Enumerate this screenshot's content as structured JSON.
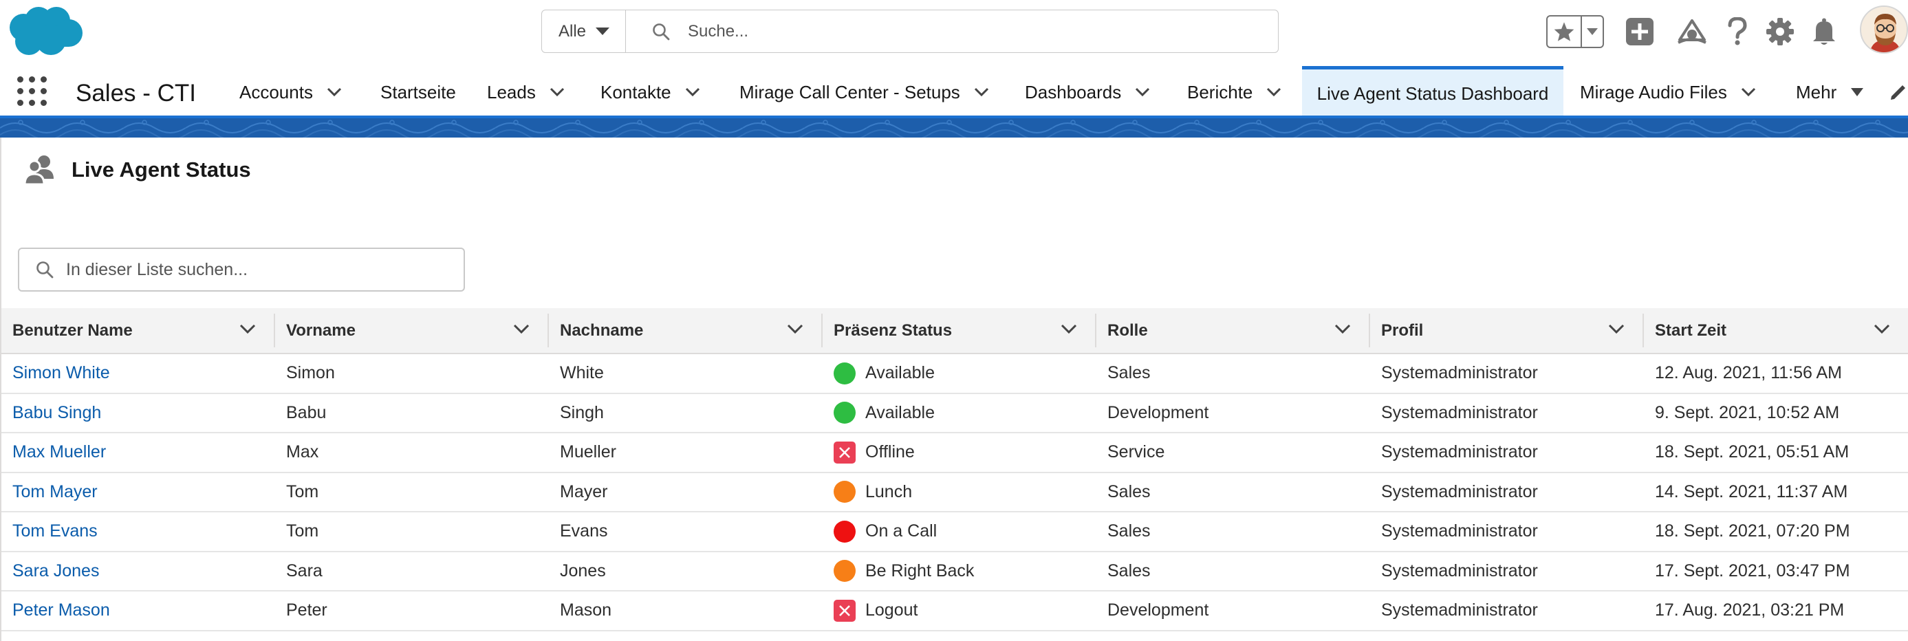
{
  "header": {
    "scope_label": "Alle",
    "search_placeholder": "Suche..."
  },
  "nav": {
    "app_name": "Sales - CTI",
    "items": [
      {
        "label": "Accounts",
        "has_menu": true
      },
      {
        "label": "Startseite",
        "has_menu": false
      },
      {
        "label": "Leads",
        "has_menu": true
      },
      {
        "label": "Kontakte",
        "has_menu": true
      },
      {
        "label": "Mirage Call Center - Setups",
        "has_menu": true
      },
      {
        "label": "Dashboards",
        "has_menu": true
      },
      {
        "label": "Berichte",
        "has_menu": true
      },
      {
        "label": "Live Agent Status Dashboard",
        "has_menu": false,
        "active": true
      },
      {
        "label": "Mirage Audio Files",
        "has_menu": true
      },
      {
        "label": "Mehr",
        "has_menu": true
      }
    ]
  },
  "page": {
    "title": "Live Agent Status",
    "list_search_placeholder": "In dieser Liste suchen..."
  },
  "table": {
    "columns": [
      "Benutzer Name",
      "Vorname",
      "Nachname",
      "Präsenz Status",
      "Rolle",
      "Profil",
      "Start Zeit"
    ],
    "rows": [
      {
        "user": "Simon White",
        "first": "Simon",
        "last": "White",
        "status": "Available",
        "status_icon": "green-dot",
        "role": "Sales",
        "profile": "Systemadministrator",
        "start": "12. Aug. 2021, 11:56 AM"
      },
      {
        "user": "Babu Singh",
        "first": "Babu",
        "last": "Singh",
        "status": "Available",
        "status_icon": "green-dot",
        "role": "Development",
        "profile": "Systemadministrator",
        "start": "9. Sept. 2021, 10:52 AM"
      },
      {
        "user": "Max Mueller",
        "first": "Max",
        "last": "Mueller",
        "status": "Offline",
        "status_icon": "red-x-box",
        "role": "Service",
        "profile": "Systemadministrator",
        "start": "18. Sept. 2021, 05:51 AM"
      },
      {
        "user": "Tom Mayer",
        "first": "Tom",
        "last": "Mayer",
        "status": "Lunch",
        "status_icon": "orange-dot",
        "role": "Sales",
        "profile": "Systemadministrator",
        "start": "14. Sept. 2021, 11:37 AM"
      },
      {
        "user": "Tom Evans",
        "first": "Tom",
        "last": "Evans",
        "status": "On a Call",
        "status_icon": "red-dot",
        "role": "Sales",
        "profile": "Systemadministrator",
        "start": "18. Sept. 2021, 07:20 PM"
      },
      {
        "user": "Sara Jones",
        "first": "Sara",
        "last": "Jones",
        "status": "Be Right Back",
        "status_icon": "orange-dot",
        "role": "Sales",
        "profile": "Systemadministrator",
        "start": "17. Sept. 2021, 03:47 PM"
      },
      {
        "user": "Peter Mason",
        "first": "Peter",
        "last": "Mason",
        "status": "Logout",
        "status_icon": "red-x-box",
        "role": "Development",
        "profile": "Systemadministrator",
        "start": "17. Aug. 2021, 03:21 PM"
      }
    ]
  },
  "colors": {
    "brand_blue": "#1b71d1",
    "link_blue": "#0b5cab",
    "cloud_blue": "#1798c1",
    "status_green": "#2ebd42",
    "status_orange": "#f77f17",
    "status_red": "#ee1111",
    "x_box_red": "#ea3f55"
  }
}
